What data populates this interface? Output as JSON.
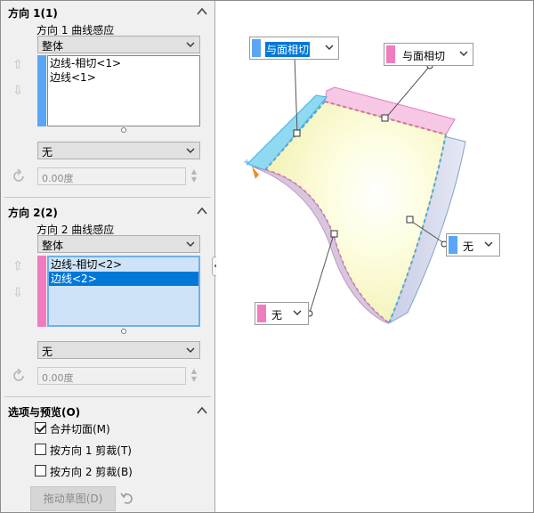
{
  "direction1": {
    "title": "方向 1(1)",
    "curve_label": "方向 1 曲线感应",
    "influence_value": "整体",
    "list_items": [
      "边线-相切<1>",
      "边线<1>"
    ],
    "color": "#5aa5f5",
    "tangent_value": "无",
    "angle_value": "0.00度"
  },
  "direction2": {
    "title": "方向 2(2)",
    "curve_label": "方向 2 曲线感应",
    "influence_value": "整体",
    "list_items": [
      "边线-相切<2>",
      "边线<2>"
    ],
    "selected_index": 1,
    "color": "#f07cc0",
    "tangent_value": "无",
    "angle_value": "0.00度"
  },
  "options": {
    "title": "选项与预览(O)",
    "merge_label": "合并切面(M)",
    "merge_checked": true,
    "trim1_label": "按方向 1 剪裁(T)",
    "trim1_checked": false,
    "trim2_label": "按方向 2 剪裁(B)",
    "trim2_checked": false,
    "drag_sketch_label": "拖动草图(D)"
  },
  "callouts": {
    "top_left": {
      "value": "与面相切",
      "color": "#5aa5f5"
    },
    "top_right": {
      "value": "与面相切",
      "color": "#f07cc0"
    },
    "right": {
      "value": "无",
      "color": "#5aa5f5"
    },
    "bottom_left": {
      "value": "无",
      "color": "#f07cc0"
    }
  },
  "icons": {
    "collapse": "chevron-up-icon",
    "move_up": "arrow-up-icon",
    "move_down": "arrow-down-icon",
    "reverse": "reverse-direction-icon",
    "undo": "undo-icon",
    "dropdown": "chevron-down-icon"
  }
}
